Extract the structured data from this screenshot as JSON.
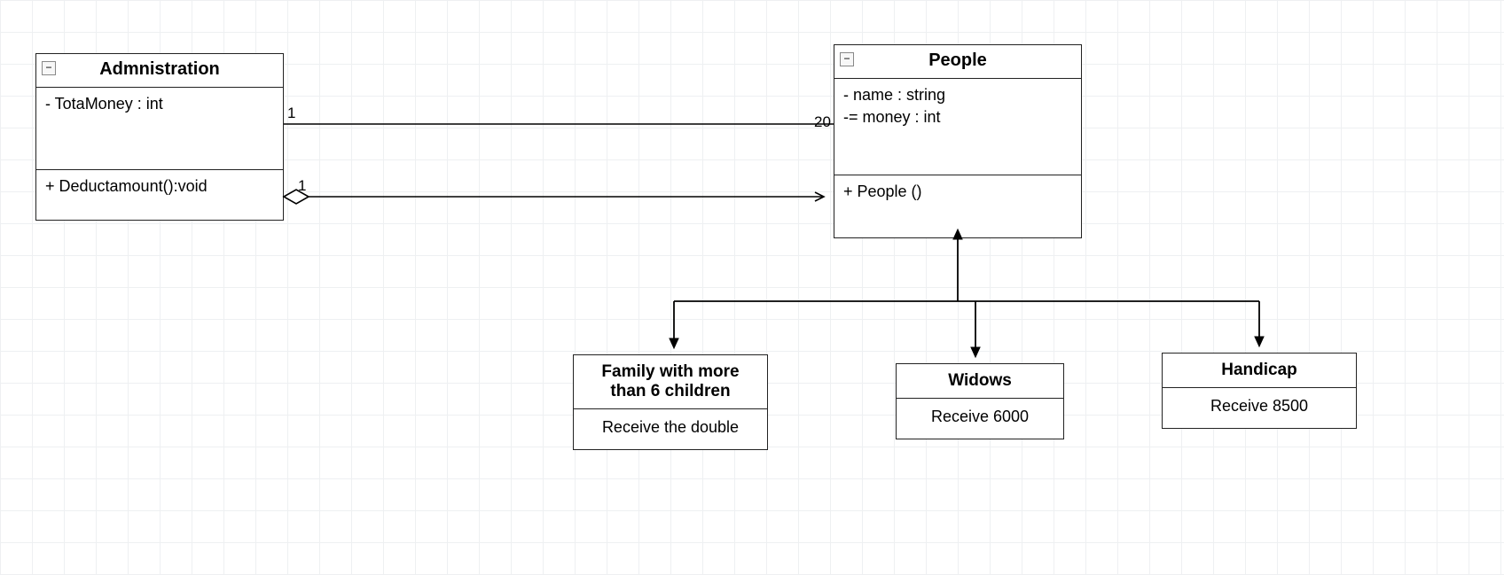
{
  "classes": {
    "administration": {
      "title": "Admnistration",
      "attrs": [
        "- TotaMoney : int"
      ],
      "ops": [
        "+ Deductamount():void"
      ],
      "toggle": "−"
    },
    "people": {
      "title": "People",
      "attrs": [
        "- name : string",
        "-= money : int"
      ],
      "ops": [
        "+ People ()"
      ],
      "toggle": "−"
    }
  },
  "subclasses": {
    "family": {
      "title": "Family with more than 6 children",
      "body": "Receive the double"
    },
    "widows": {
      "title": "Widows",
      "body": "Receive 6000"
    },
    "handicap": {
      "title": "Handicap",
      "body": "Receive 8500"
    }
  },
  "cardinalities": {
    "admin_top_right": "1",
    "admin_bottom_right": "1",
    "people_left": "20"
  }
}
